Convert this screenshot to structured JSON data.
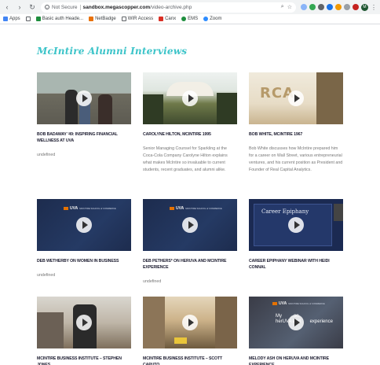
{
  "browser": {
    "back": "‹",
    "forward": "›",
    "reload": "↻",
    "secure_label": "Not Secure",
    "url_host": "sandbox.megascopper.com",
    "url_path": "/video-archive.php"
  },
  "bookmarks": [
    {
      "label": "Apps",
      "color": "#4285f4"
    },
    {
      "label": "",
      "color": "#5f6368"
    },
    {
      "label": "Basic auth Heade...",
      "color": "#1e8e3e"
    },
    {
      "label": "NetBadge",
      "color": "#e8710a"
    },
    {
      "label": "WIR Access",
      "color": "#5f6368"
    },
    {
      "label": "Canx",
      "color": "#d93025"
    },
    {
      "label": "EMS",
      "color": "#1e8e3e"
    },
    {
      "label": "Zoom",
      "color": "#2d8cff"
    }
  ],
  "page": {
    "title": "McIntire Alumni Interviews"
  },
  "videos": [
    {
      "title": "Bob Badaway '49: Inspiring Financial Wellness at UVA",
      "desc": "undefined"
    },
    {
      "title": "Carolyne Hilton, McIntire 1995",
      "desc": "Senior Managing Counsel for Sparkling at the Coca-Cola Company Carolyne Hilton explains what makes McIntire so invaluable to current students, recent graduates, and alumni alike."
    },
    {
      "title": "Bob White, McIntire 1967",
      "desc": "Bob White discusses how McIntire prepared him for a career on Wall Street, various entrepreneurial ventures, and his current position as President and Founder of Real Capital Analytics."
    },
    {
      "title": "Deb Wetherby on Women in Business",
      "desc": "undefined"
    },
    {
      "title": "Deb Pethers* on Heruva and McIntire Experience",
      "desc": "undefined"
    },
    {
      "title": "Career Epiphany Webinar with Heidi Connal",
      "desc": ""
    },
    {
      "title": "McIntire Business Institute – Stephen Jones",
      "desc": ""
    },
    {
      "title": "McIntire Business Institute – Scott Caputo",
      "desc": ""
    },
    {
      "title": "Melody Ash on heruva and McIntire Experience",
      "desc": ""
    }
  ],
  "thumb_text": {
    "rca": "RCA",
    "uva": "UVA",
    "uva_sub": "MCINTIRE SCHOOL of COMMERCE",
    "career": "Career Epiphany",
    "overlay_line1": "My",
    "overlay_line2": "on",
    "overlay_line3": "herUVA and",
    "overlay_line4": "experience"
  },
  "colors": {
    "accent_title": "#3cc4c9",
    "uva_orange": "#e57200",
    "uva_navy": "#1d2c4e"
  }
}
